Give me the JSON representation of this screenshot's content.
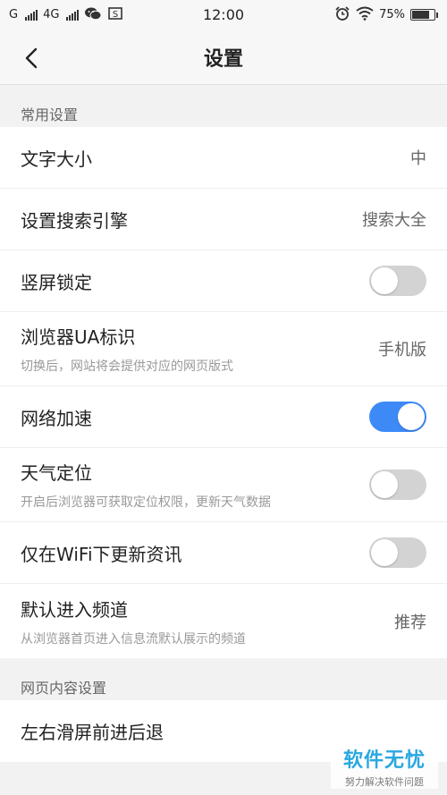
{
  "status_bar": {
    "carrier1": "G",
    "carrier2": "4G",
    "time": "12:00",
    "battery": "75%",
    "icons": [
      "signal-icon",
      "wechat-icon",
      "screenshot-icon",
      "alarm-icon",
      "wifi-icon",
      "battery-icon"
    ]
  },
  "header": {
    "title": "设置",
    "back_icon": "chevron-left-icon"
  },
  "sections": [
    {
      "title": "常用设置",
      "rows": [
        {
          "label": "文字大小",
          "value": "中"
        },
        {
          "label": "设置搜索引擎",
          "value": "搜索大全"
        },
        {
          "label": "竖屏锁定",
          "toggle": false
        },
        {
          "label": "浏览器UA标识",
          "sub": "切换后，网站将会提供对应的网页版式",
          "value": "手机版"
        },
        {
          "label": "网络加速",
          "toggle": true
        },
        {
          "label": "天气定位",
          "sub": "开启后浏览器可获取定位权限，更新天气数据",
          "toggle": false
        },
        {
          "label": "仅在WiFi下更新资讯",
          "toggle": false
        },
        {
          "label": "默认进入频道",
          "sub": "从浏览器首页进入信息流默认展示的频道",
          "value": "推荐"
        }
      ]
    },
    {
      "title": "网页内容设置",
      "rows": [
        {
          "label": "左右滑屏前进后退"
        }
      ]
    }
  ],
  "watermark": {
    "main": "软件无忧",
    "sub": "努力解决软件问题"
  },
  "colors": {
    "accent": "#3d8af7",
    "toggle_off": "#d3d3d3",
    "watermark": "#2aa8e0"
  }
}
